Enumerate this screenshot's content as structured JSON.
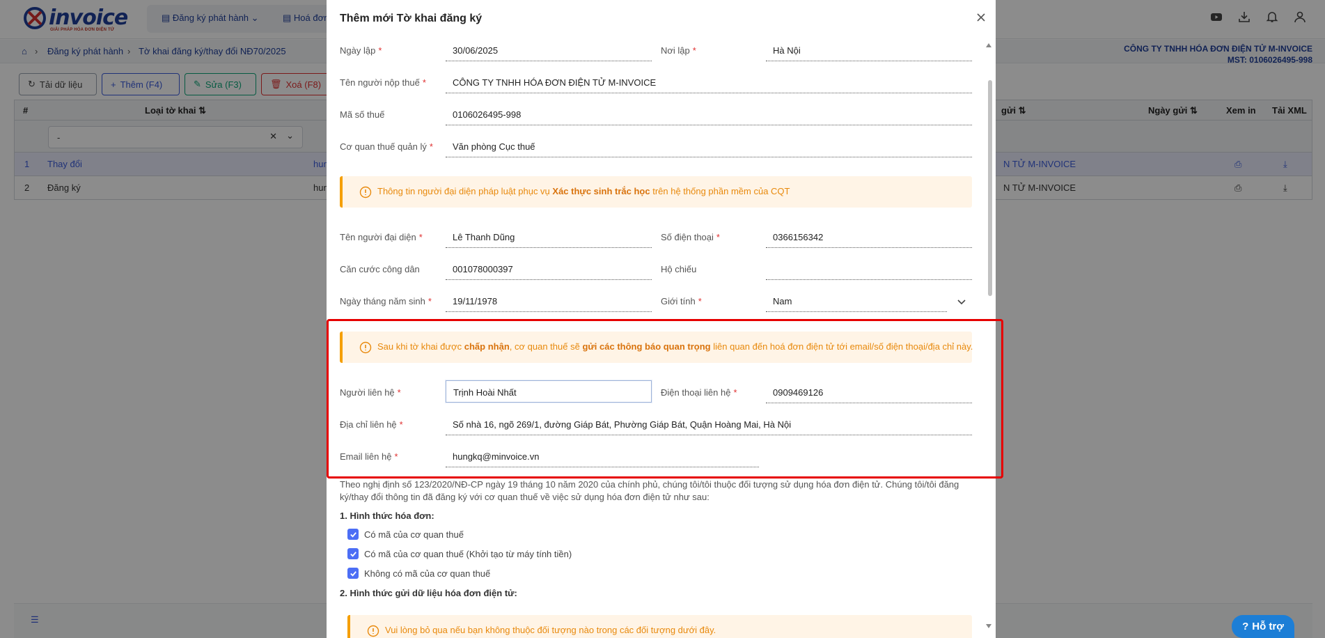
{
  "app": {
    "logo_text": "invoice",
    "logo_tagline": "GIẢI PHÁP HÓA ĐƠN ĐIỆN TỬ",
    "nav": [
      {
        "label": "Đăng ký phát hành"
      },
      {
        "label": "Hoá đơn"
      }
    ],
    "breadcrumb": [
      "Đăng ký phát hành",
      "Tờ khai đăng ký/thay đổi NĐ70/2025"
    ],
    "company_name": "CÔNG TY TNHH HÓA ĐƠN ĐIỆN TỬ M-INVOICE",
    "company_mst": "MST: 0106026495-998",
    "toolbar": {
      "reload": "Tải dữ liệu",
      "add": "Thêm (F4)",
      "edit": "Sửa (F3)",
      "delete": "Xoá (F8)"
    },
    "grid": {
      "headers": {
        "num": "#",
        "type": "Loại tờ khai",
        "sender": "gửi",
        "send_date": "Ngày gửi",
        "print": "Xem in",
        "xml": "Tải XML"
      },
      "filter_value": "-",
      "rows": [
        {
          "num": "1",
          "type": "Thay đổi",
          "partial": "hun",
          "company_tail": "N TỬ M-INVOICE"
        },
        {
          "num": "2",
          "type": "Đăng ký",
          "partial": "hun",
          "company_tail": "N TỬ M-INVOICE"
        }
      ]
    },
    "support": "Hỗ trợ"
  },
  "modal": {
    "title": "Thêm mới Tờ khai đăng ký",
    "fields": {
      "ngay_lap": {
        "label": "Ngày lập",
        "value": "30/06/2025"
      },
      "noi_lap": {
        "label": "Nơi lập",
        "value": "Hà Nội"
      },
      "ten_nguoi_nop_thue": {
        "label": "Tên người nộp thuế",
        "value": "CÔNG TY TNHH HÓA ĐƠN ĐIỆN TỬ M-INVOICE"
      },
      "ma_so_thue": {
        "label": "Mã số thuế",
        "value": "0106026495-998"
      },
      "co_quan_thue": {
        "label": "Cơ quan thuế quản lý",
        "value": "Văn phòng Cục thuế"
      },
      "ten_nguoi_dai_dien": {
        "label": "Tên người đại diện",
        "value": "Lê Thanh Dũng"
      },
      "so_dien_thoai": {
        "label": "Số điện thoại",
        "value": "0366156342"
      },
      "can_cuoc": {
        "label": "Căn cước công dân",
        "value": "001078000397"
      },
      "ho_chieu": {
        "label": "Hộ chiếu",
        "value": ""
      },
      "ngay_sinh": {
        "label": "Ngày tháng năm sinh",
        "value": "19/11/1978"
      },
      "gioi_tinh": {
        "label": "Giới tính",
        "value": "Nam"
      },
      "nguoi_lien_he": {
        "label": "Người liên hệ",
        "value": "Trịnh Hoài Nhất"
      },
      "dien_thoai_lien_he": {
        "label": "Điện thoại liên hệ",
        "value": "0909469126"
      },
      "dia_chi_lien_he": {
        "label": "Địa chỉ liên hệ",
        "value": "Số nhà 16, ngõ 269/1, đường Giáp Bát, Phường Giáp Bát, Quận Hoàng Mai, Hà Nội"
      },
      "email_lien_he": {
        "label": "Email liên hệ",
        "value": "hungkq@minvoice.vn"
      }
    },
    "notice1": {
      "pre": "Thông tin người đại diện pháp luật phục vụ ",
      "bold": "Xác thực sinh trắc học",
      "post": " trên hệ thống phần mềm của CQT"
    },
    "notice2": {
      "pre": "Sau khi tờ khai được ",
      "bold1": "chấp nhận",
      "mid": ", cơ quan thuế sẽ ",
      "bold2": "gửi các thông báo quan trọng",
      "post": " liên quan đến hoá đơn điện tử tới email/số điện thoại/địa chỉ này."
    },
    "paragraph": "Theo nghị định số 123/2020/NĐ-CP ngày 19 tháng 10 năm 2020 của chính phủ, chúng tôi/tôi thuộc đối tượng sử dụng hóa đơn điện tử. Chúng tôi/tôi đăng ký/thay đổi thông tin đã đăng ký với cơ quan thuế về việc sử dụng hóa đơn điện tử như sau:",
    "section1": "1. Hình thức hóa đơn:",
    "checkboxes": [
      {
        "label": "Có mã của cơ quan thuế",
        "checked": true
      },
      {
        "label": "Có mã của cơ quan thuế (Khởi tạo từ máy tính tiền)",
        "checked": true
      },
      {
        "label": "Không có mã của cơ quan thuế",
        "checked": true
      }
    ],
    "section2": "2. Hình thức gửi dữ liệu hóa đơn điện tử:",
    "notice3": "Vui lòng bỏ qua nếu bạn không thuộc đối tượng nào trong các đối tượng dưới đây."
  },
  "colors": {
    "brand": "#1f3f9a",
    "accent": "#3b5bdb",
    "notice_bg": "#fff4e6",
    "notice_border": "#f59f00",
    "highlight": "#e60000"
  }
}
